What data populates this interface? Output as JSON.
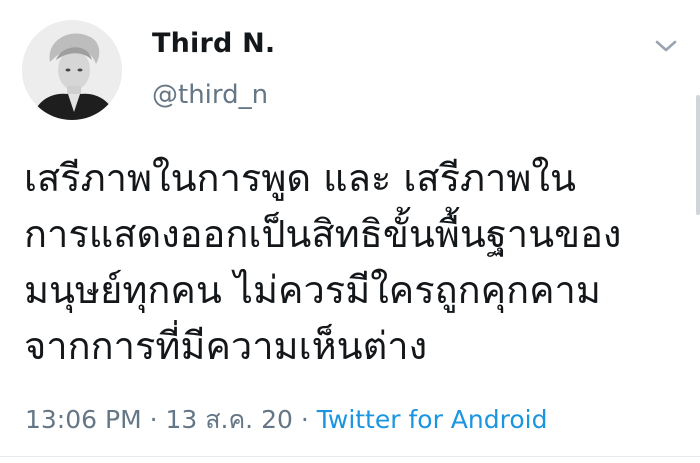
{
  "author": {
    "display_name": "Third N.",
    "handle": "@third_n",
    "avatar_icon": "profile-photo"
  },
  "tweet": {
    "text": "เสรีภาพในการพูด และ เสรีภาพใน\nการแสดงออกเป็นสิทธิขั้นพื้นฐานของ\nมนุษย์ทุกคน ไม่ควรมีใครถูกคุกคาม\nจากการที่มีความเห็นต่าง",
    "time": "13:06 PM",
    "separator": " · ",
    "date": "13 ส.ค. 20",
    "source": "Twitter for Android"
  },
  "menu": {
    "icon": "chevron-down-icon"
  },
  "colors": {
    "text_primary": "#14171a",
    "text_secondary": "#657786",
    "link": "#1b95e0"
  }
}
